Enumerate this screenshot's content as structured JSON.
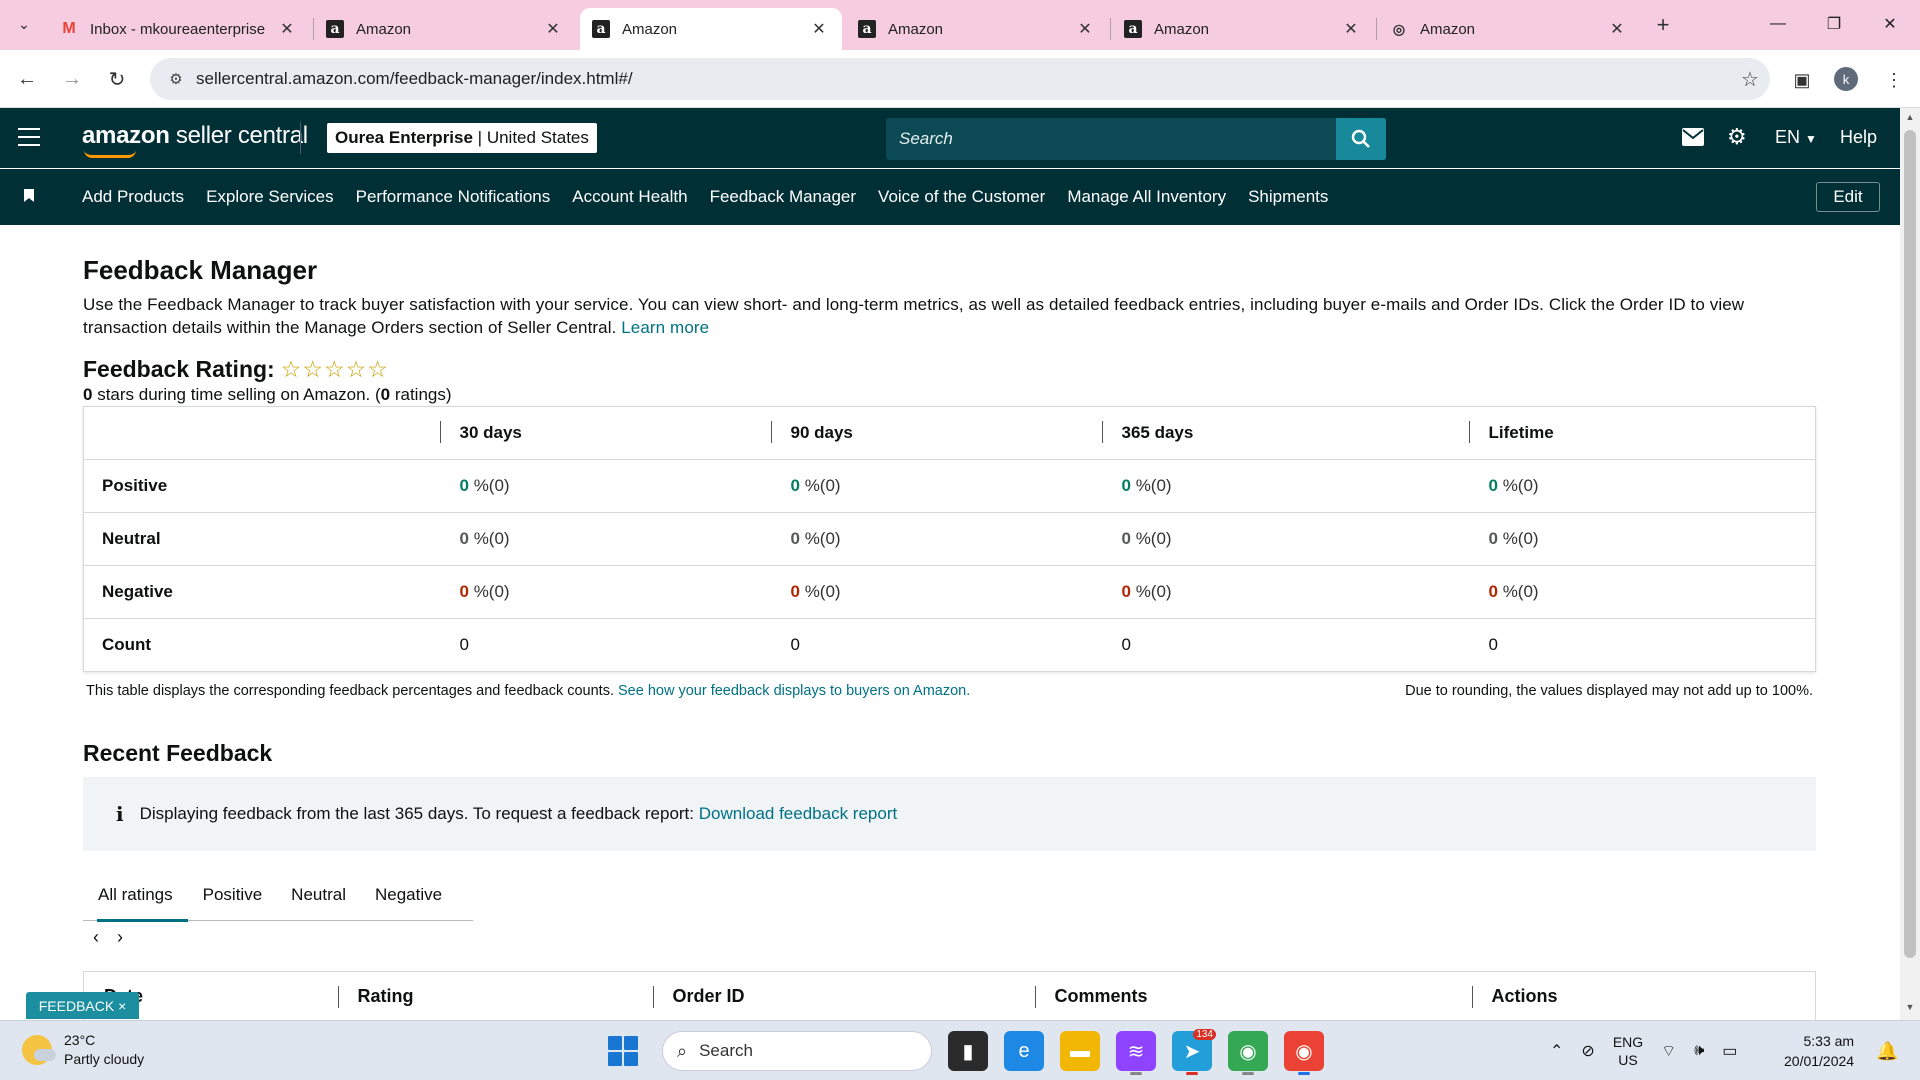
{
  "browser": {
    "tabs": [
      {
        "title": "Inbox - mkoureaenterprise",
        "favicon": "gmail-icon"
      },
      {
        "title": "Amazon",
        "favicon": "amazon-icon"
      },
      {
        "title": "Amazon",
        "favicon": "amazon-icon",
        "active": true
      },
      {
        "title": "Amazon",
        "favicon": "amazon-icon"
      },
      {
        "title": "Amazon",
        "favicon": "amazon-icon"
      },
      {
        "title": "Amazon",
        "favicon": "amazon-smile-icon"
      }
    ],
    "url": "sellercentral.amazon.com/feedback-manager/index.html#/",
    "profile_initial": "k"
  },
  "header": {
    "logo_bold": "amazon",
    "logo_rest": " seller central",
    "store_name": "Ourea Enterprise",
    "marketplace": "United States",
    "search_placeholder": "Search",
    "language": "EN",
    "help": "Help"
  },
  "nav": {
    "links": [
      "Add Products",
      "Explore Services",
      "Performance Notifications",
      "Account Health",
      "Feedback Manager",
      "Voice of the Customer",
      "Manage All Inventory",
      "Shipments"
    ],
    "edit": "Edit"
  },
  "page": {
    "title": "Feedback Manager",
    "intro": "Use the Feedback Manager to track buyer satisfaction with your service. You can view short- and long-term metrics, as well as detailed feedback entries, including buyer e-mails and Order IDs. Click the Order ID to view transaction details within the Manage Orders section of Seller Central.",
    "learn_more": "Learn more",
    "rating_label": "Feedback Rating:",
    "stars": "☆☆☆☆☆",
    "stars_value": "0",
    "stars_text": " stars during time selling on Amazon. (",
    "ratings_value": "0",
    "ratings_text": " ratings)"
  },
  "metrics": {
    "columns": [
      "30 days",
      "90 days",
      "365 days",
      "Lifetime"
    ],
    "rows": [
      {
        "label": "Positive",
        "values": [
          "0",
          "0",
          "0",
          "0"
        ],
        "counts": [
          " %(0)",
          " %(0)",
          " %(0)",
          " %(0)"
        ]
      },
      {
        "label": "Neutral",
        "values": [
          "0",
          "0",
          "0",
          "0"
        ],
        "counts": [
          " %(0)",
          " %(0)",
          " %(0)",
          " %(0)"
        ]
      },
      {
        "label": "Negative",
        "values": [
          "0",
          "0",
          "0",
          "0"
        ],
        "counts": [
          " %(0)",
          " %(0)",
          " %(0)",
          " %(0)"
        ]
      },
      {
        "label": "Count",
        "values": [
          "0",
          "0",
          "0",
          "0"
        ]
      }
    ],
    "footnote": "This table displays the corresponding feedback percentages and feedback counts.",
    "footnote_link": "See how your feedback displays to buyers on Amazon.",
    "rounding_note": "Due to rounding, the values displayed may not add up to 100%."
  },
  "recent": {
    "title": "Recent Feedback",
    "info_text": "Displaying feedback from the last 365 days. To request a feedback report:",
    "info_link": "Download feedback report",
    "tabs": [
      "All ratings",
      "Positive",
      "Neutral",
      "Negative"
    ],
    "table_headers": [
      "Date",
      "Rating",
      "Order ID",
      "Comments",
      "Actions"
    ]
  },
  "feedback_tag": "FEEDBACK ×",
  "taskbar": {
    "temperature": "23°C",
    "weather": "Partly cloudy",
    "search": "Search",
    "telegram_badge": "134",
    "lang_top": "ENG",
    "lang_bottom": "US",
    "time": "5:33 am",
    "date": "20/01/2024"
  }
}
